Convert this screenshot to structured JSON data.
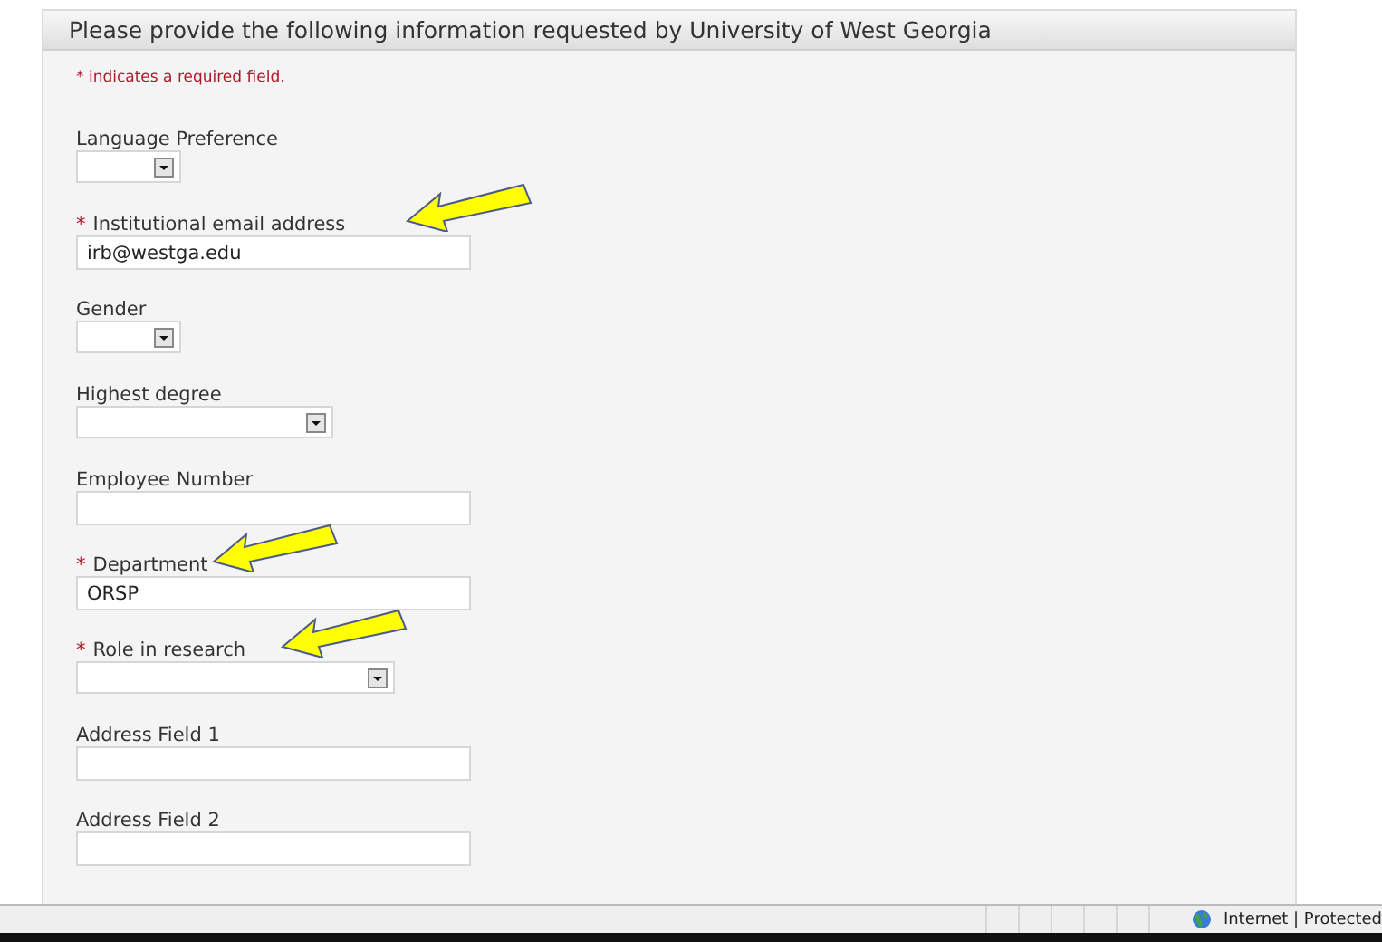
{
  "panel": {
    "title": "Please provide the following information requested by University of West Georgia",
    "required_note": "* indicates a required field."
  },
  "fields": [
    {
      "label": "Language Preference",
      "kind": "shortselect",
      "annotated": false
    },
    {
      "marker": "*",
      "label": "Institutional email address",
      "kind": "text",
      "annotated": true,
      "value": "irb@westga.edu"
    },
    {
      "label": "Gender",
      "kind": "shortselect",
      "annotated": false
    },
    {
      "label": "Highest degree",
      "kind": "select",
      "annotated": false
    },
    {
      "label": "Employee Number",
      "kind": "text",
      "annotated": false
    },
    {
      "marker": "*",
      "label": "Department",
      "kind": "text",
      "annotated": true,
      "value": "ORSP"
    },
    {
      "marker": "*",
      "label": "Role in research",
      "kind": "longselect",
      "annotated": true
    },
    {
      "label": "Address Field 1",
      "kind": "text",
      "annotated": false
    },
    {
      "label": "Address Field 2",
      "kind": "text",
      "annotated": false
    }
  ],
  "status_bar": {
    "zone": "Internet | Protected"
  }
}
